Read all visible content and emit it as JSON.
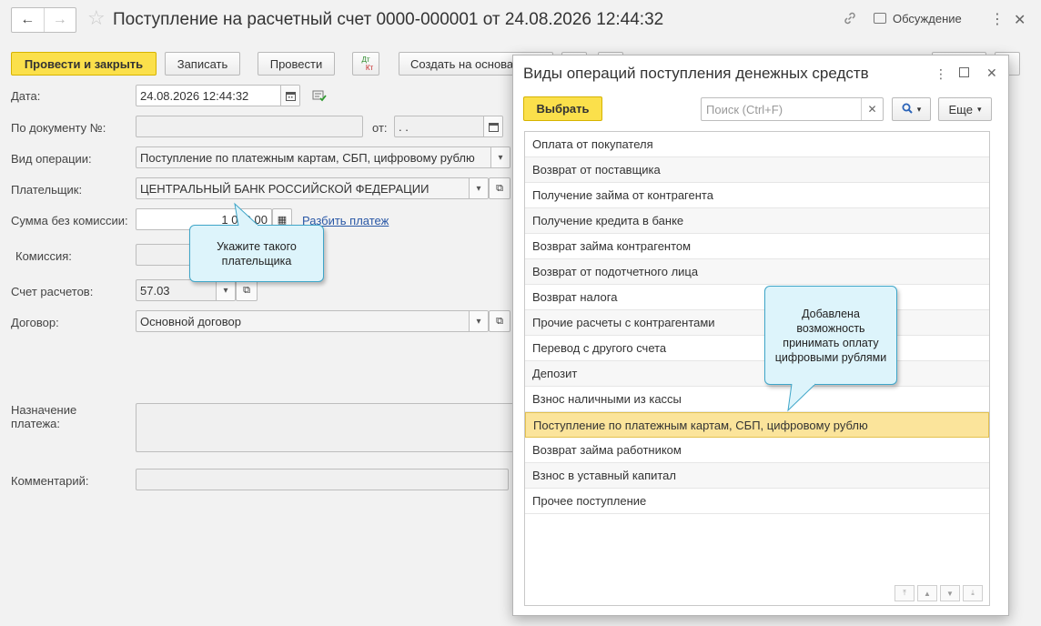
{
  "header": {
    "title": "Поступление на расчетный счет 0000-000001 от 24.08.2026 12:44:32",
    "back_icon": "←",
    "forward_icon": "→",
    "favorite_icon": "☆",
    "link_icon": "🔗",
    "more_icon": "⋮",
    "close_icon": "✕",
    "discuss_label": "Обсуждение"
  },
  "toolbar": {
    "post_close": "Провести и закрыть",
    "save": "Записать",
    "post": "Провести",
    "dtkt_top": "Дт",
    "dtkt_bottom": "Кт",
    "create_based": "Создать на основании"
  },
  "form": {
    "date_label": "Дата:",
    "date_value": "24.08.2026 12:44:32",
    "doc_num_label": "По документу №:",
    "doc_num_value": "",
    "from_label": "от:",
    "from_value": " .  .",
    "operation_label": "Вид операции:",
    "operation_value": "Поступление по платежным картам, СБП, цифровому рублю",
    "payer_label": "Плательщик:",
    "payer_value": "ЦЕНТРАЛЬНЫЙ БАНК РОССИЙСКОЙ ФЕДЕРАЦИИ",
    "amount_label": "Сумма без комиссии:",
    "amount_value": "1 000,00",
    "split_link": "Разбить платеж",
    "commission_label": "Комиссия:",
    "commission_value": "",
    "account_label": "Счет расчетов:",
    "account_value": "57.03",
    "contract_label": "Договор:",
    "contract_value": "Основной договор",
    "purpose_label_1": "Назначение",
    "purpose_label_2": "платежа:",
    "purpose_value": "",
    "comment_label": "Комментарий:",
    "comment_value": ""
  },
  "callouts": {
    "payer_line1": "Укажите такого",
    "payer_line2": "плательщика",
    "added_line1": "Добавлена",
    "added_line2": "возможность",
    "added_line3": "принимать оплату",
    "added_line4": "цифровыми рублями"
  },
  "dialog": {
    "title": "Виды операций поступления денежных средств",
    "select_button": "Выбрать",
    "search_placeholder": "Поиск (Ctrl+F)",
    "search_value": "",
    "more_button": "Еще",
    "items": [
      "Оплата от покупателя",
      "Возврат от поставщика",
      "Получение займа от контрагента",
      "Получение кредита в банке",
      "Возврат займа контрагентом",
      "Возврат от подотчетного лица",
      "Возврат налога",
      "Прочие расчеты с контрагентами",
      "Перевод с другого счета",
      "Депозит",
      "Взнос наличными из кассы",
      "Поступление по платежным картам, СБП, цифровому рублю",
      "Возврат займа работником",
      "Взнос в уставный капитал",
      "Прочее поступление"
    ],
    "selected_index": 11
  },
  "colors": {
    "accent_yellow": "#fbe04b",
    "selected_row": "#fbe49b",
    "callout_bg": "#ddf4fb",
    "callout_border": "#3fa6c9",
    "link": "#2a58a6"
  }
}
